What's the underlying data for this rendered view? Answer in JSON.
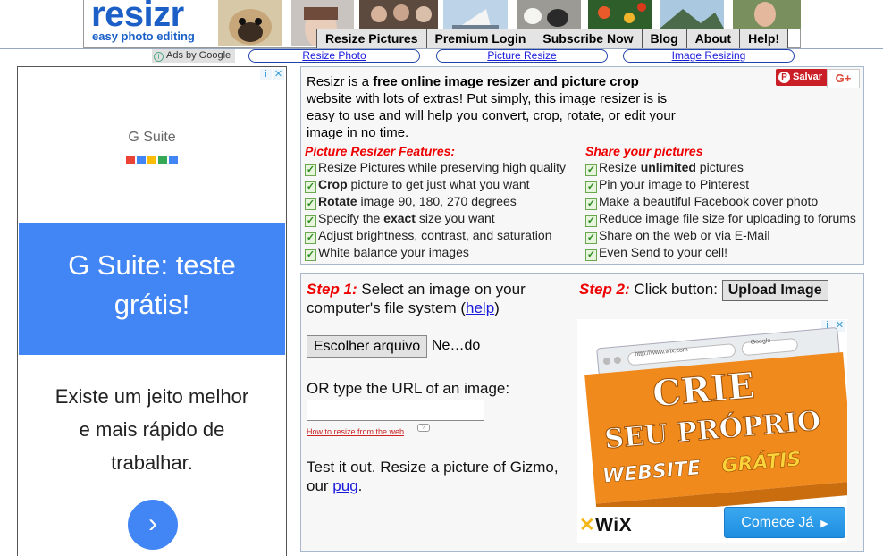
{
  "header": {
    "logo": "resizr",
    "tagline": "easy photo editing",
    "nav": [
      "Resize Pictures",
      "Premium Login",
      "Subscribe Now",
      "Blog",
      "About",
      "Help!"
    ]
  },
  "adbar": {
    "ads_by": "Ads by Google",
    "links": [
      "Resize Photo",
      "Picture Resize",
      "Image Resizing"
    ]
  },
  "left_ad": {
    "brand": "G Suite",
    "headline_1": "G Suite: teste",
    "headline_2": "grátis!",
    "body_1": "Existe um jeito melhor",
    "body_2": "e mais rápido de",
    "body_3": "trabalhar.",
    "arrow": "›"
  },
  "info": {
    "intro_1": "Resizr is a ",
    "intro_bold_1": "free online image resizer and picture crop",
    "intro_2": " website with lots of extras! Put simply, this image resizer is is easy to use and will help you convert, crop, rotate, or edit your image in no time.",
    "pinit": "Salvar",
    "gplus": "G+",
    "features_title": "Picture Resizer Features:",
    "features": [
      {
        "pre": "Resize Pictures while preserving high quality",
        "bold": "",
        "post": ""
      },
      {
        "pre": "",
        "bold": "Crop",
        "post": " picture to get just what you want"
      },
      {
        "pre": "",
        "bold": "Rotate",
        "post": " image 90, 180, 270 degrees"
      },
      {
        "pre": "Specify the ",
        "bold": "exact",
        "post": " size you want"
      },
      {
        "pre": "Adjust brightness, contrast, and saturation",
        "bold": "",
        "post": ""
      },
      {
        "pre": "White balance your images",
        "bold": "",
        "post": ""
      }
    ],
    "share_title": "Share your pictures",
    "share": [
      {
        "pre": "Resize ",
        "bold": "unlimited",
        "post": " pictures"
      },
      {
        "pre": "Pin your image to Pinterest",
        "bold": "",
        "post": ""
      },
      {
        "pre": "Make a beautiful Facebook cover photo",
        "bold": "",
        "post": ""
      },
      {
        "pre": "Reduce image file size for uploading to forums",
        "bold": "",
        "post": ""
      },
      {
        "pre": "Share on the web or via E-Mail",
        "bold": "",
        "post": ""
      },
      {
        "pre": "Even Send to your cell!",
        "bold": "",
        "post": ""
      }
    ]
  },
  "steps": {
    "step1_label": "Step 1:",
    "step1_text": " Select an image on your computer's file system (",
    "help": "help",
    "step1_end": ")",
    "step2_label": "Step 2:",
    "step2_text": " Click button: ",
    "upload": "Upload Image",
    "file_button": "Escolher arquivo",
    "file_name": "Ne…do",
    "url_label": "OR type the URL of an image:",
    "url_value": "",
    "how_link": "How to resize from the web",
    "test_text": "Test it out. Resize a picture of Gizmo, our ",
    "pug": "pug",
    "test_end": "."
  },
  "wix_ad": {
    "line1": "CRIE",
    "line2": "SEU PRÓPRIO",
    "line3": "WEBSITE",
    "line3b": "GRÁTIS",
    "browser_url": "http://www.wix.com",
    "search": "Google",
    "logo": "WiX",
    "button": "Comece Já",
    "button_arrow": "▶"
  },
  "colors": {
    "brand_blue": "#1b5fc7",
    "red_heading": "#ee0000",
    "gsuite_blue": "#4285f4",
    "wix_orange": "#f08a1c"
  }
}
